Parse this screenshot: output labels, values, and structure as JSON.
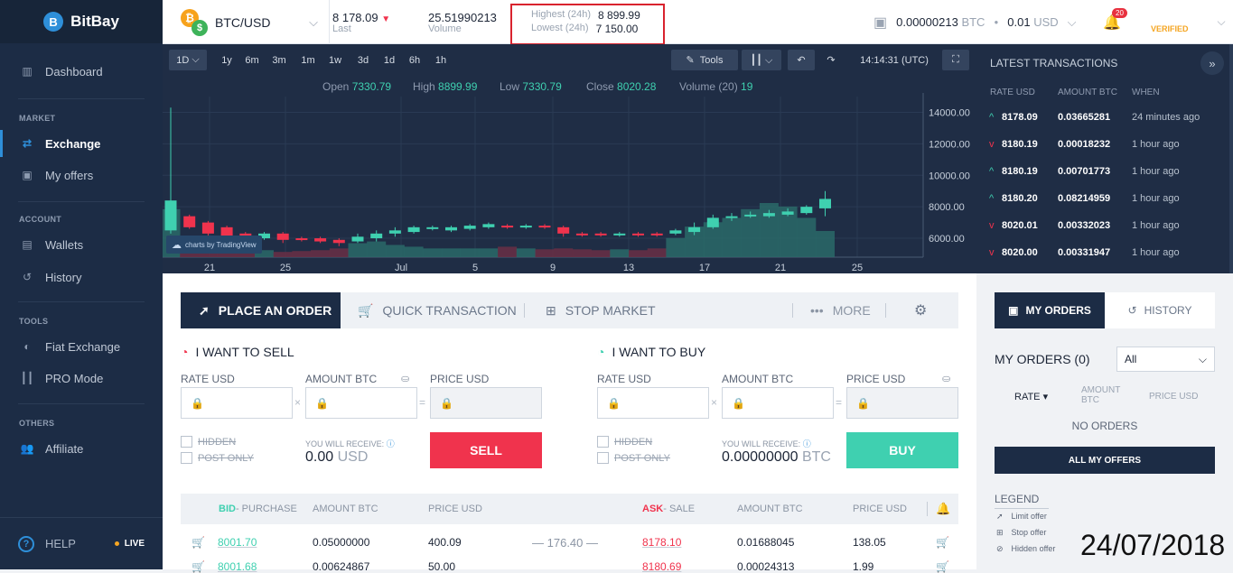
{
  "brand": {
    "name": "BitBay"
  },
  "sidebar": {
    "dashboard": "Dashboard",
    "market_head": "MARKET",
    "exchange": "Exchange",
    "my_offers": "My offers",
    "account_head": "ACCOUNT",
    "wallets": "Wallets",
    "history": "History",
    "tools_head": "TOOLS",
    "fiat_exchange": "Fiat Exchange",
    "pro_mode": "PRO Mode",
    "others_head": "OTHERS",
    "affiliate": "Affiliate",
    "help": "HELP",
    "live": "LIVE"
  },
  "topbar": {
    "pair": "BTC/USD",
    "last_value": "8 178.09",
    "last_label": "Last",
    "volume_value": "25.51990213",
    "volume_label": "Volume",
    "highest_label": "Highest (24h)",
    "highest_value": "8 899.99",
    "lowest_label": "Lowest (24h)",
    "lowest_value": "7 150.00",
    "btc_balance": "0.00000213",
    "btc_unit": "BTC",
    "usd_balance": "0.01",
    "usd_unit": "USD",
    "notifications": "20",
    "verified": "VERIFIED"
  },
  "chart_toolbar": {
    "interval": "1D",
    "ranges": [
      "1y",
      "6m",
      "3m",
      "1m",
      "1w",
      "3d",
      "1d",
      "6h",
      "1h"
    ],
    "tools": "Tools",
    "time": "14:14:31 (UTC)"
  },
  "ohlc": {
    "open_label": "Open",
    "open": "7330.79",
    "high_label": "High",
    "high": "8899.99",
    "low_label": "Low",
    "low": "7330.79",
    "close_label": "Close",
    "close": "8020.28",
    "volume_label": "Volume (20)",
    "volume": "19"
  },
  "chart_data": {
    "type": "candlestick",
    "x_ticks": [
      "21",
      "25",
      "Jul",
      "5",
      "9",
      "13",
      "17",
      "21",
      "25"
    ],
    "y_ticks": [
      "14000.00",
      "12000.00",
      "10000.00",
      "8000.00",
      "6000.00"
    ],
    "ylim": [
      4800,
      15000
    ],
    "watermark": "charts by TradingView",
    "candles": [
      {
        "o": 6500,
        "c": 8400,
        "h": 14300,
        "l": 6300,
        "up": true
      },
      {
        "o": 7400,
        "c": 6700,
        "h": 7500,
        "l": 6600,
        "up": false
      },
      {
        "o": 7000,
        "c": 6300,
        "h": 7100,
        "l": 6100,
        "up": false
      },
      {
        "o": 6700,
        "c": 6100,
        "h": 6800,
        "l": 6000,
        "up": false
      },
      {
        "o": 6300,
        "c": 5900,
        "h": 6400,
        "l": 5800,
        "up": false
      },
      {
        "o": 6000,
        "c": 6300,
        "h": 6400,
        "l": 5900,
        "up": true
      },
      {
        "o": 6300,
        "c": 5900,
        "h": 6400,
        "l": 5700,
        "up": false
      },
      {
        "o": 6000,
        "c": 5900,
        "h": 6100,
        "l": 5800,
        "up": false
      },
      {
        "o": 6000,
        "c": 5800,
        "h": 6100,
        "l": 5700,
        "up": false
      },
      {
        "o": 5900,
        "c": 5700,
        "h": 6000,
        "l": 5500,
        "up": false
      },
      {
        "o": 5800,
        "c": 6100,
        "h": 6300,
        "l": 5700,
        "up": true
      },
      {
        "o": 6000,
        "c": 6300,
        "h": 6500,
        "l": 5800,
        "up": true
      },
      {
        "o": 6300,
        "c": 6500,
        "h": 6700,
        "l": 6100,
        "up": true
      },
      {
        "o": 6400,
        "c": 6700,
        "h": 6800,
        "l": 6300,
        "up": true
      },
      {
        "o": 6600,
        "c": 6700,
        "h": 6800,
        "l": 6500,
        "up": true
      },
      {
        "o": 6500,
        "c": 6700,
        "h": 6800,
        "l": 6400,
        "up": true
      },
      {
        "o": 6600,
        "c": 6800,
        "h": 6900,
        "l": 6500,
        "up": true
      },
      {
        "o": 6700,
        "c": 6900,
        "h": 7000,
        "l": 6600,
        "up": true
      },
      {
        "o": 6800,
        "c": 6700,
        "h": 6900,
        "l": 6600,
        "up": false
      },
      {
        "o": 6700,
        "c": 6800,
        "h": 6900,
        "l": 6600,
        "up": true
      },
      {
        "o": 6800,
        "c": 6700,
        "h": 6900,
        "l": 6600,
        "up": false
      },
      {
        "o": 6700,
        "c": 6300,
        "h": 6800,
        "l": 6100,
        "up": false
      },
      {
        "o": 6300,
        "c": 6200,
        "h": 6400,
        "l": 6100,
        "up": false
      },
      {
        "o": 6300,
        "c": 6200,
        "h": 6400,
        "l": 6100,
        "up": false
      },
      {
        "o": 6200,
        "c": 6300,
        "h": 6400,
        "l": 6100,
        "up": true
      },
      {
        "o": 6300,
        "c": 6200,
        "h": 6400,
        "l": 6100,
        "up": false
      },
      {
        "o": 6300,
        "c": 6200,
        "h": 6400,
        "l": 6100,
        "up": false
      },
      {
        "o": 6300,
        "c": 6500,
        "h": 6600,
        "l": 6200,
        "up": true
      },
      {
        "o": 6400,
        "c": 6700,
        "h": 7000,
        "l": 6200,
        "up": true
      },
      {
        "o": 6700,
        "c": 7300,
        "h": 7500,
        "l": 6600,
        "up": true
      },
      {
        "o": 7300,
        "c": 7400,
        "h": 7600,
        "l": 7100,
        "up": true
      },
      {
        "o": 7400,
        "c": 7500,
        "h": 7700,
        "l": 7300,
        "up": true
      },
      {
        "o": 7400,
        "c": 7600,
        "h": 7800,
        "l": 7300,
        "up": true
      },
      {
        "o": 7500,
        "c": 7700,
        "h": 7900,
        "l": 7400,
        "up": true
      },
      {
        "o": 7600,
        "c": 8000,
        "h": 8100,
        "l": 7500,
        "up": true
      },
      {
        "o": 7900,
        "c": 8500,
        "h": 9000,
        "l": 7400,
        "up": true
      }
    ],
    "volume": [
      55,
      18,
      10,
      9,
      6,
      8,
      6,
      7,
      8,
      10,
      16,
      18,
      14,
      12,
      10,
      10,
      10,
      10,
      12,
      10,
      9,
      10,
      9,
      8,
      9,
      8,
      10,
      22,
      35,
      40,
      45,
      55,
      62,
      58,
      45,
      30
    ]
  },
  "latest": {
    "title": "LATEST TRANSACTIONS",
    "col_rate": "RATE USD",
    "col_amount": "AMOUNT BTC",
    "col_when": "WHEN",
    "rows": [
      {
        "rate": "8178.09",
        "amount": "0.03665281",
        "when": "24 minutes ago",
        "up": true
      },
      {
        "rate": "8180.19",
        "amount": "0.00018232",
        "when": "1 hour ago",
        "up": false
      },
      {
        "rate": "8180.19",
        "amount": "0.00701773",
        "when": "1 hour ago",
        "up": true
      },
      {
        "rate": "8180.20",
        "amount": "0.08214959",
        "when": "1 hour ago",
        "up": true
      },
      {
        "rate": "8020.01",
        "amount": "0.00332023",
        "when": "1 hour ago",
        "up": false
      },
      {
        "rate": "8020.00",
        "amount": "0.00331947",
        "when": "1 hour ago",
        "up": false
      }
    ]
  },
  "order": {
    "tab_place": "PLACE AN ORDER",
    "tab_quick": "QUICK TRANSACTION",
    "tab_stop": "STOP MARKET",
    "tab_more": "MORE",
    "sell_title": "I WANT TO SELL",
    "buy_title": "I WANT TO BUY",
    "rate_label": "RATE USD",
    "amount_label": "AMOUNT BTC",
    "price_label": "PRICE USD",
    "hidden": "HIDDEN",
    "post_only": "POST ONLY",
    "receive_label": "YOU WILL RECEIVE:",
    "sell_receive": "0.00",
    "sell_receive_unit": "USD",
    "buy_receive": "0.00000000",
    "buy_receive_unit": "BTC",
    "sell_btn": "SELL",
    "buy_btn": "BUY"
  },
  "book": {
    "bid": "BID",
    "bid_rest": " - PURCHASE",
    "ask": "ASK",
    "ask_rest": "- SALE",
    "amount": "AMOUNT BTC",
    "price": "PRICE USD",
    "spread": "176.40",
    "bid_rows": [
      {
        "rate": "8001.70",
        "amount": "0.05000000",
        "price": "400.09"
      },
      {
        "rate": "8001.68",
        "amount": "0.00624867",
        "price": "50.00"
      }
    ],
    "ask_rows": [
      {
        "rate": "8178.10",
        "amount": "0.01688045",
        "price": "138.05"
      },
      {
        "rate": "8180.69",
        "amount": "0.00024313",
        "price": "1.99"
      }
    ]
  },
  "myorders": {
    "tab_orders": "MY ORDERS",
    "tab_history": "HISTORY",
    "title": "MY ORDERS (0)",
    "filter": "All",
    "col_rate": "RATE",
    "col_amount": "AMOUNT BTC",
    "col_price": "PRICE USD",
    "empty": "NO ORDERS",
    "all_offers": "ALL MY OFFERS",
    "legend": "LEGEND",
    "legend_limit": "Limit offer",
    "legend_stop": "Stop offer",
    "legend_hidden": "Hidden offer"
  },
  "overlay": {
    "date": "24/07/2018"
  },
  "colors": {
    "up": "#3fd0b0",
    "down": "#f0334d",
    "navy": "#1c2c45",
    "blue": "#2e8fd9"
  }
}
